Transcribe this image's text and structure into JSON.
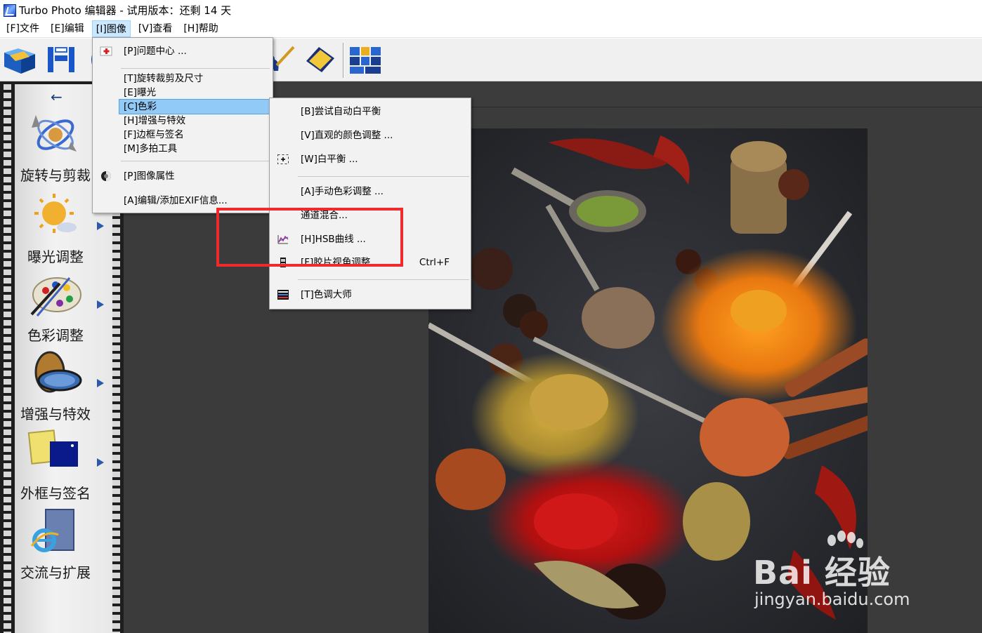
{
  "window": {
    "title": "Turbo Photo 编辑器  - 试用版本：还剩 14 天"
  },
  "menubar": {
    "items": [
      {
        "label": "[F]文件"
      },
      {
        "label": "[E]编辑"
      },
      {
        "label": "[I]图像"
      },
      {
        "label": "[V]查看"
      },
      {
        "label": "[H]帮助"
      }
    ]
  },
  "sidebar": {
    "back_icon": "left-arrow-icon",
    "categories": [
      {
        "label": "旋转与剪裁",
        "icon": "rotate-crop-icon"
      },
      {
        "label": "曝光调整",
        "icon": "sun-exposure-icon"
      },
      {
        "label": "色彩调整",
        "icon": "palette-icon"
      },
      {
        "label": "增强与特效",
        "icon": "lens-filter-icon"
      },
      {
        "label": "外框与签名",
        "icon": "frame-icon"
      },
      {
        "label": "交流与扩展",
        "icon": "internet-explorer-icon"
      }
    ]
  },
  "image_menu": {
    "items": [
      {
        "label": "[P]问题中心 ..."
      },
      {
        "label": "[T]旋转裁剪及尺寸"
      },
      {
        "label": "[E]曝光"
      },
      {
        "label": "[C]色彩"
      },
      {
        "label": "[H]增强与特效"
      },
      {
        "label": "[F]边框与签名"
      },
      {
        "label": "[M]多拍工具"
      },
      {
        "label": "[P]图像属性"
      },
      {
        "label": "[A]编辑/添加EXIF信息..."
      }
    ]
  },
  "color_submenu": {
    "items": [
      {
        "label": "[B]尝试自动白平衡"
      },
      {
        "label": "[V]直观的颜色调整 ..."
      },
      {
        "label": "[W]白平衡 ..."
      },
      {
        "label": "[A]手动色彩调整 ..."
      },
      {
        "label": "通道混合..."
      },
      {
        "label": "[H]HSB曲线 ..."
      },
      {
        "label": "[F]胶片视角调整",
        "shortcut": "Ctrl+F"
      },
      {
        "label": "[T]色调大师"
      }
    ]
  },
  "watermark": {
    "brand": "Bai 经验",
    "url": "jingyan.baidu.com"
  },
  "colors": {
    "annotation": "#ee2a2a",
    "menu_highlight": "#91c9f7",
    "workspace": "#3c3c3c"
  }
}
